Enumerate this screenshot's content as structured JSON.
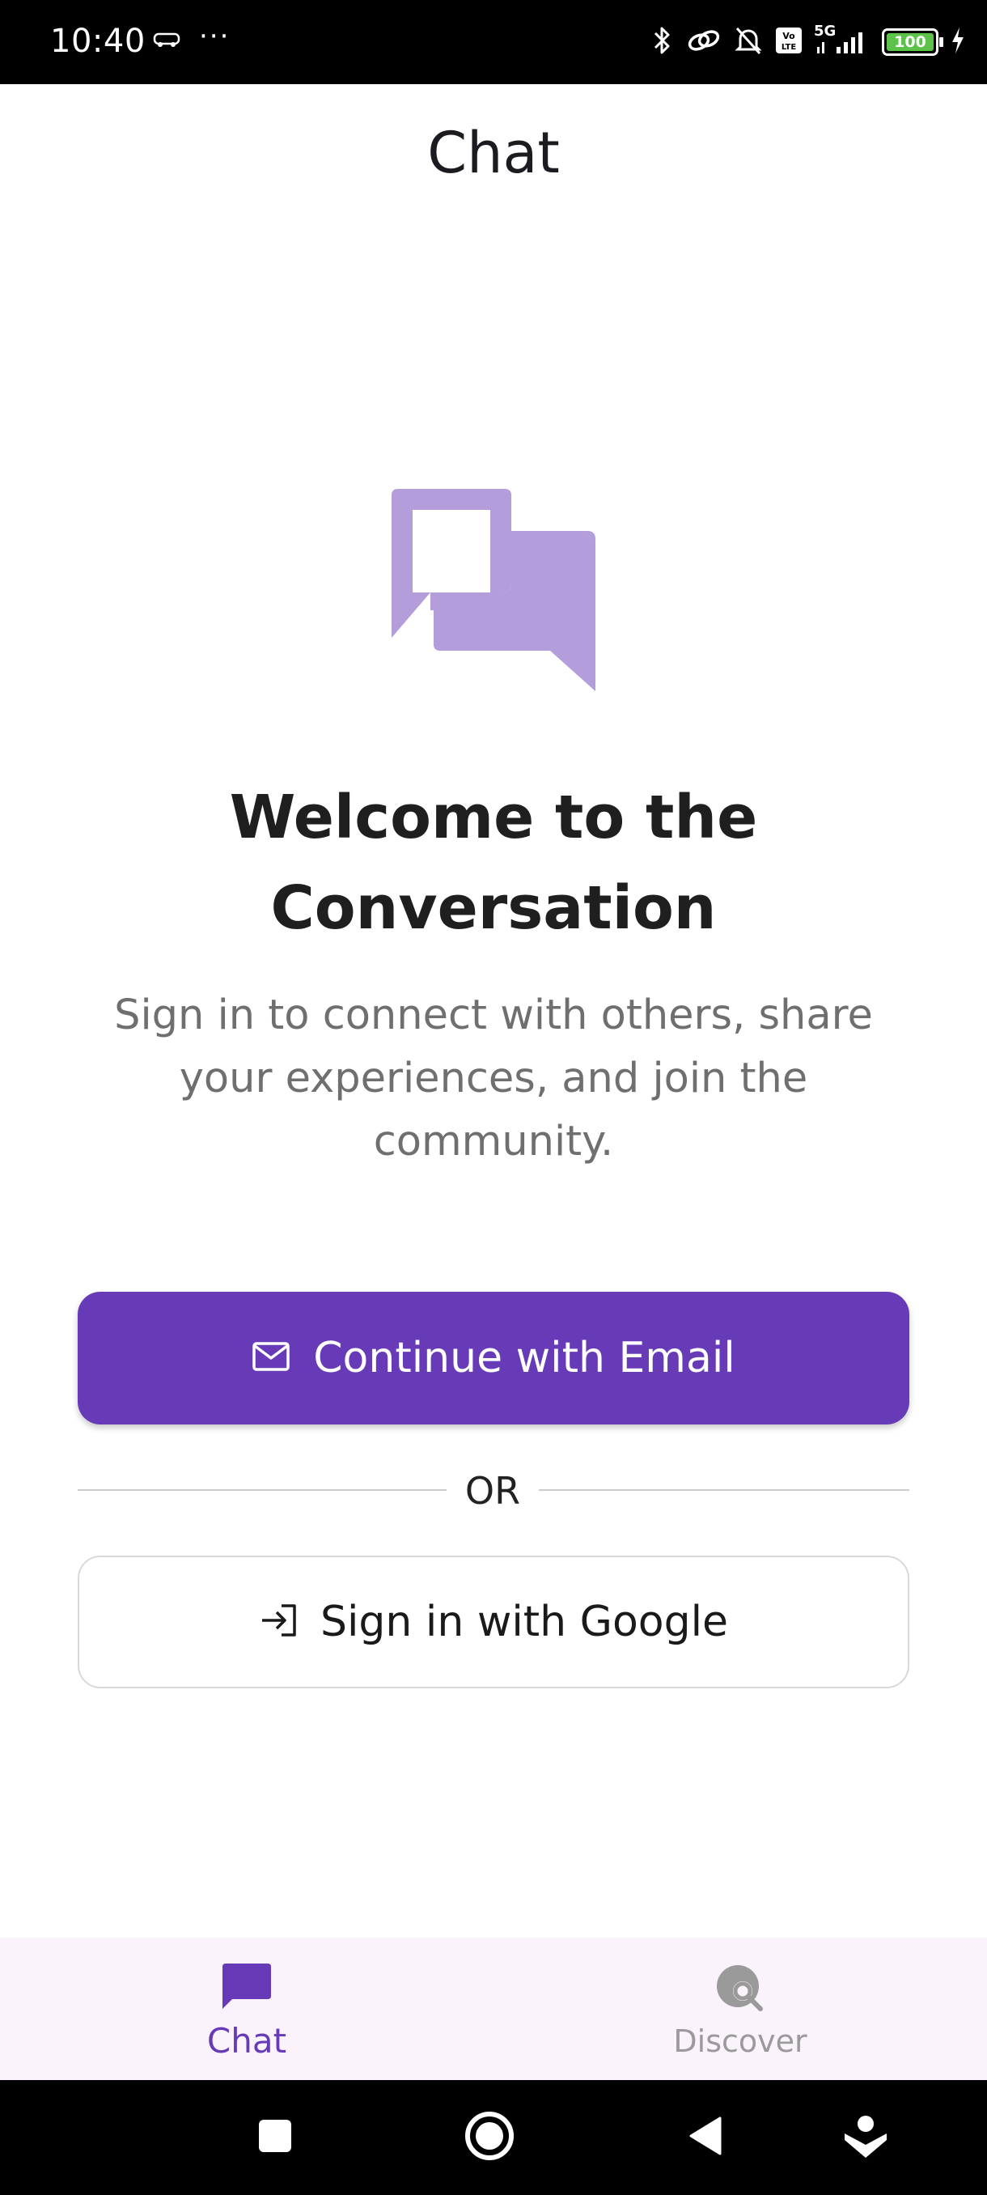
{
  "status_bar": {
    "time": "10:40",
    "more": "···",
    "battery": "100",
    "network": "5G"
  },
  "app_bar": {
    "title": "Chat"
  },
  "welcome": {
    "title": "Welcome to the Conversation",
    "subtitle": "Sign in to connect with others, share your experiences, and join the community."
  },
  "auth": {
    "email_button": "Continue with Email",
    "divider": "OR",
    "google_button": "Sign in with Google"
  },
  "bottom_nav": {
    "items": [
      {
        "label": "Chat",
        "icon": "chat-bubble-icon",
        "active": true
      },
      {
        "label": "Discover",
        "icon": "discover-icon",
        "active": false
      }
    ]
  },
  "colors": {
    "primary": "#673ab7",
    "hero_icon": "#b39ddb",
    "nav_background": "#fbf3fc",
    "subtitle_text": "#6f6f6f"
  }
}
